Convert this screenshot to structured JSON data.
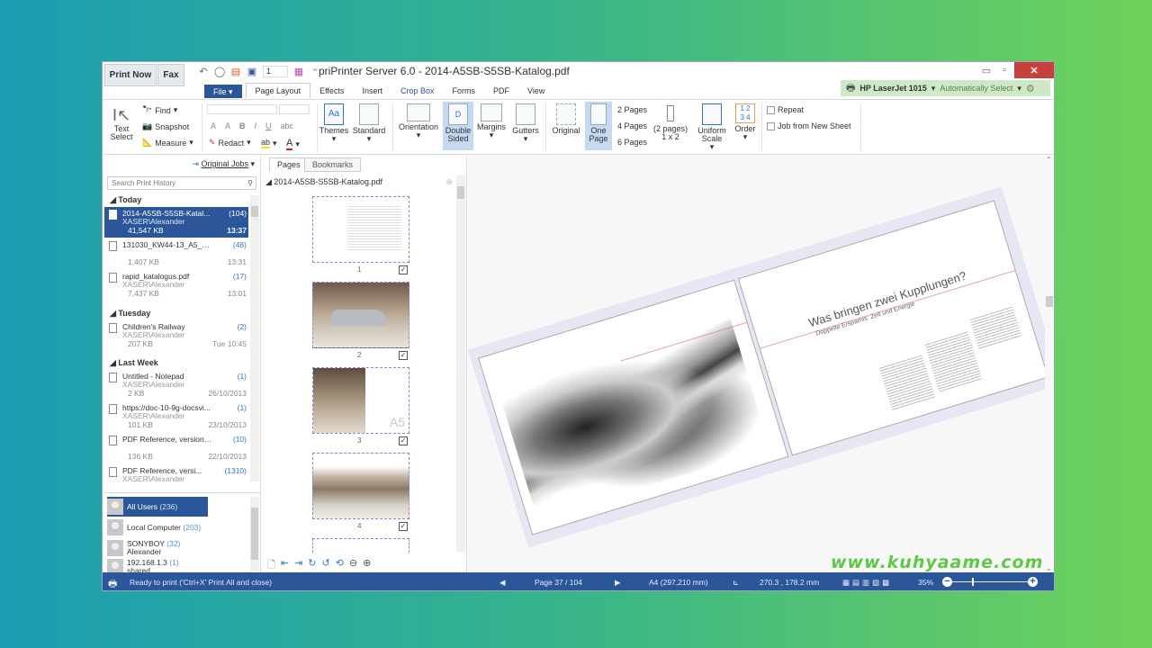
{
  "window": {
    "title": "priPrinter Server 6.0 - 2014-A5SB-S5SB-Katalog.pdf",
    "print_now": "Print Now",
    "fax": "Fax",
    "copies": "1",
    "minimize": "▭",
    "maximize": "▫",
    "close": "✕"
  },
  "menu": {
    "tabs": [
      {
        "label": "File ▾",
        "type": "file"
      },
      {
        "label": "Page Layout",
        "type": "active"
      },
      {
        "label": "Effects"
      },
      {
        "label": "Insert"
      },
      {
        "label": "Crop Box"
      },
      {
        "label": "Forms"
      },
      {
        "label": "PDF"
      },
      {
        "label": "View"
      }
    ]
  },
  "printer": {
    "name": "HP LaserJet 1015",
    "tray": "Automatically Select"
  },
  "ribbon": {
    "text_select": "Text Select",
    "find": "Find",
    "snapshot": "Snapshot",
    "measure": "Measure",
    "redact": "Redact",
    "bold": "B",
    "italic": "I",
    "underline": "U",
    "strike": "abc",
    "grow": "A",
    "shrink": "A",
    "themes": "Themes",
    "standard": "Standard",
    "orientation": "Orientation",
    "double_sided": "Double Sided",
    "margins": "Margins",
    "gutters": "Gutters",
    "original": "Original",
    "one_page": "One Page",
    "two_pages": "2 Pages",
    "four_pages": "4 Pages",
    "six_pages": "6 Pages",
    "n_pages": "(2 pages)",
    "n_layout": "1 x 2",
    "uniform_scale": "Uniform Scale",
    "order": "Order",
    "repeat": "Repeat",
    "job_from_new_sheet": "Job from New Sheet"
  },
  "history": {
    "original_jobs": "Original Jobs",
    "search_placeholder": "Search Print History",
    "groups": [
      {
        "title": "Today",
        "jobs": [
          {
            "name": "2014-A5SB-S5SB-Katal...",
            "count": "(104)",
            "user": "XASER\\Alexander",
            "size": "41,547 KB",
            "time": "13:37",
            "selected": true
          },
          {
            "name": "131030_KW44-13_A5_S...",
            "count": "(48)",
            "user": "",
            "size": "1,407 KB",
            "time": "13:31"
          },
          {
            "name": "rapid_katalogus.pdf",
            "count": "(17)",
            "user": "XASER\\Alexander",
            "size": "7,437 KB",
            "time": "13:01"
          }
        ]
      },
      {
        "title": "Tuesday",
        "jobs": [
          {
            "name": "Children's Railway",
            "count": "(2)",
            "user": "XASER\\Alexander",
            "size": "207 KB",
            "time": "Tue 10:45"
          }
        ]
      },
      {
        "title": "Last Week",
        "jobs": [
          {
            "name": "Untitled - Notepad",
            "count": "(1)",
            "user": "XASER\\Alexander",
            "size": "2 KB",
            "time": "26/10/2013"
          },
          {
            "name": "https://doc-10-9g-docsvi...",
            "count": "(1)",
            "user": "XASER\\Alexander",
            "size": "101 KB",
            "time": "23/10/2013"
          },
          {
            "name": "PDF Reference, version ...",
            "count": "(10)",
            "user": "",
            "size": "136 KB",
            "time": "22/10/2013"
          },
          {
            "name": "PDF Reference, versi...",
            "count": "(1310)",
            "user": "XASER\\Alexander",
            "size": "",
            "time": ""
          }
        ]
      }
    ],
    "users": [
      {
        "name": "All Users",
        "count": "(236)",
        "sub": "",
        "selected": true
      },
      {
        "name": "Local Computer",
        "count": "(203)",
        "sub": ""
      },
      {
        "name": "SONYBOY",
        "count": "(32)",
        "sub": "Alexander"
      },
      {
        "name": "192.168.1.3",
        "count": "(1)",
        "sub": "shared"
      }
    ]
  },
  "pages_panel": {
    "tabs": [
      "Pages",
      "Bookmarks"
    ],
    "file": "2014-A5SB-S5SB-Katalog.pdf",
    "thumbnails": [
      {
        "number": "1",
        "checked": true
      },
      {
        "number": "2",
        "checked": true
      },
      {
        "number": "3",
        "checked": true,
        "label": "A5"
      },
      {
        "number": "4",
        "checked": true
      },
      {
        "number": "",
        "checked": false
      }
    ]
  },
  "preview": {
    "heading": "Was bringen zwei Kupplungen?",
    "subheading": "Doppelte Ersparnis: Zeit und Energie"
  },
  "status": {
    "message": "Ready to print ('Ctrl+X' Print All and close)",
    "page": "Page 37 / 104",
    "paper": "A4 (297,210 mm)",
    "coords": "270.3 , 178.2 mm",
    "zoom": "35%",
    "zoom_value_percent": 35
  },
  "watermark": "www.kuhyaame.com"
}
